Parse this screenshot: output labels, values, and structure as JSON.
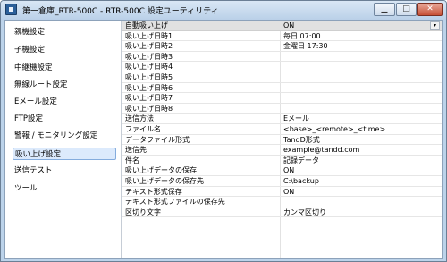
{
  "window": {
    "title": "第一倉庫_RTR-500C - RTR-500C 設定ユーティリティ",
    "min_glyph": "▁",
    "max_glyph": "□",
    "close_glyph": "✕"
  },
  "sidebar": {
    "selected_index": 7,
    "items": [
      {
        "label": "親機設定"
      },
      {
        "label": "子機設定"
      },
      {
        "label": "中継機設定"
      },
      {
        "label": "無線ルート設定"
      },
      {
        "label": "Eメール設定"
      },
      {
        "label": "FTP設定"
      },
      {
        "label": "警報 / モニタリング設定"
      },
      {
        "label": "吸い上げ設定"
      },
      {
        "label": "送信テスト"
      },
      {
        "label": "ツール"
      }
    ]
  },
  "settings": {
    "rows": [
      {
        "name": "自動吸い上げ",
        "value": "ON"
      },
      {
        "name": "吸い上げ日時1",
        "value": "毎日 07:00"
      },
      {
        "name": "吸い上げ日時2",
        "value": "金曜日 17:30"
      },
      {
        "name": "吸い上げ日時3",
        "value": ""
      },
      {
        "name": "吸い上げ日時4",
        "value": ""
      },
      {
        "name": "吸い上げ日時5",
        "value": ""
      },
      {
        "name": "吸い上げ日時6",
        "value": ""
      },
      {
        "name": "吸い上げ日時7",
        "value": ""
      },
      {
        "name": "吸い上げ日時8",
        "value": ""
      },
      {
        "name": "送信方法",
        "value": "Eメール"
      },
      {
        "name": "ファイル名",
        "value": "<base>_<remote>_<time>"
      },
      {
        "name": "データファイル形式",
        "value": "TandD形式"
      },
      {
        "name": "送信先",
        "value": "example@tandd.com"
      },
      {
        "name": "件名",
        "value": "記録データ"
      },
      {
        "name": "吸い上げデータの保存",
        "value": "ON"
      },
      {
        "name": "吸い上げデータの保存先",
        "value": "C:\\backup"
      },
      {
        "name": "テキスト形式保存",
        "value": "ON"
      },
      {
        "name": "テキスト形式ファイルの保存先",
        "value": ""
      },
      {
        "name": "区切り文字",
        "value": "カンマ区切り"
      }
    ],
    "dropdown_glyph": "▾"
  }
}
